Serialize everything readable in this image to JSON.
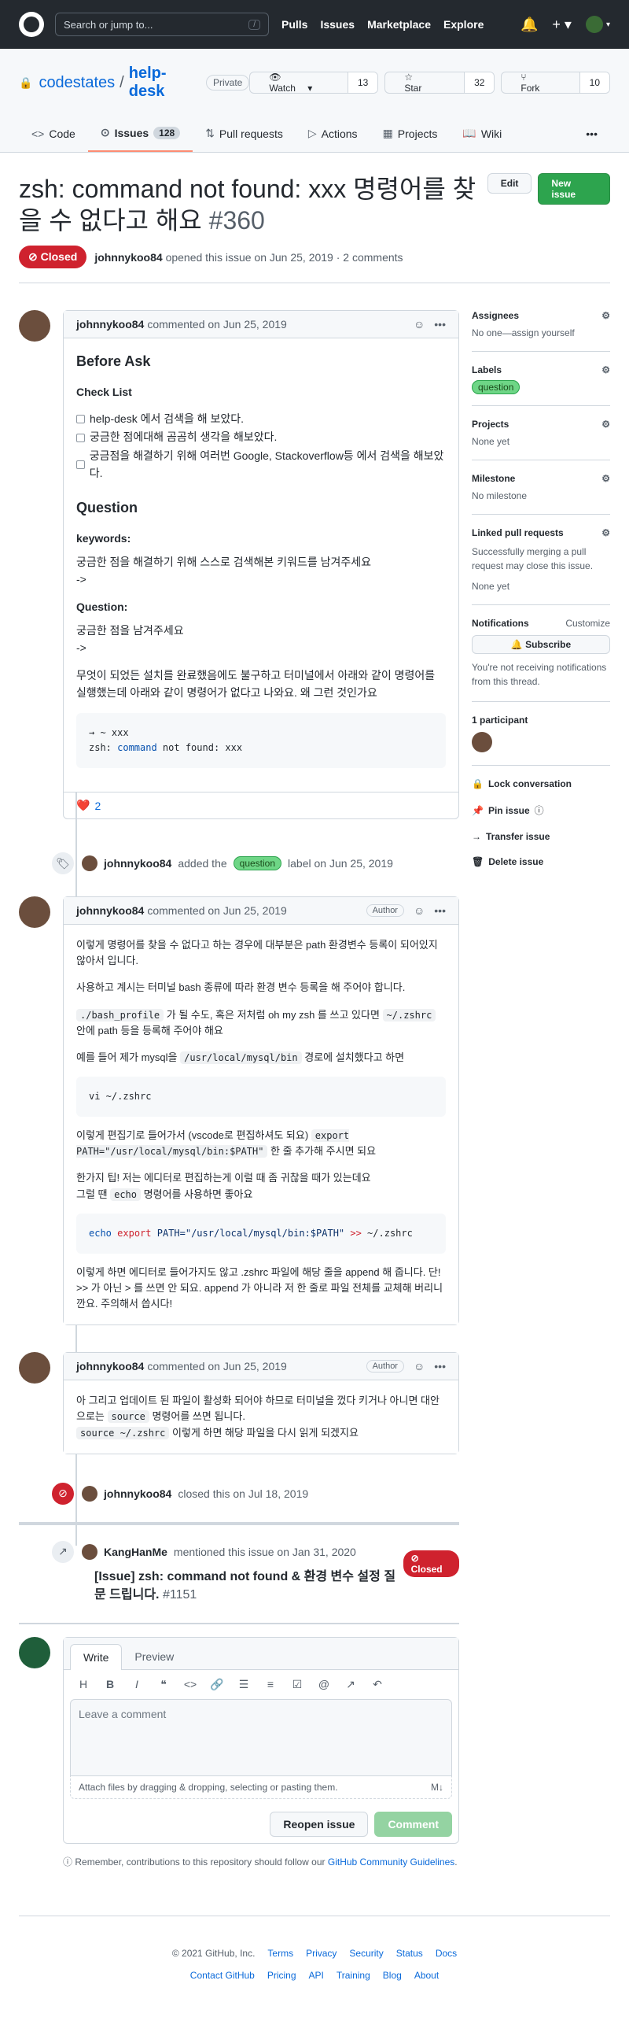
{
  "header": {
    "search_placeholder": "Search or jump to...",
    "search_shortcut": "/",
    "nav": [
      "Pulls",
      "Issues",
      "Marketplace",
      "Explore"
    ]
  },
  "repo": {
    "owner": "codestates",
    "name": "help-desk",
    "visibility": "Private",
    "watch_label": "Watch",
    "watch_count": "13",
    "star_label": "Star",
    "star_count": "32",
    "fork_label": "Fork",
    "fork_count": "10",
    "tabs": [
      {
        "label": "Code"
      },
      {
        "label": "Issues",
        "count": "128"
      },
      {
        "label": "Pull requests"
      },
      {
        "label": "Actions"
      },
      {
        "label": "Projects"
      },
      {
        "label": "Wiki"
      }
    ]
  },
  "issue": {
    "title": "zsh: command not found: xxx 명령어를 찾을 수 없다고 해요",
    "number": "#360",
    "state": "Closed",
    "edit_label": "Edit",
    "new_issue_label": "New issue",
    "author": "johnnykoo84",
    "meta_text": "opened this issue on Jun 25, 2019 · 2 comments"
  },
  "comment1": {
    "author": "johnnykoo84",
    "meta": "commented on Jun 25, 2019",
    "h_before": "Before Ask",
    "h_checklist": "Check List",
    "tasks": [
      "help-desk 에서 검색을 해 보았다.",
      "궁금한 점에대해 곰곰히 생각을 해보았다.",
      "궁금점을 해결하기 위해 여러번 Google, Stackoverflow등 에서 검색을 해보았다."
    ],
    "h_question": "Question",
    "kw_label": "keywords:",
    "kw_text": "궁금한 점을 해결하기 위해 스스로 검색해본 키워드를 남겨주세요",
    "arrow1": "->",
    "q_label": "Question:",
    "q_text": "궁금한 점을 남겨주세요",
    "arrow2": "->",
    "q_body": "무엇이 되었든 설치를 완료했음에도 불구하고 터미널에서 아래와 같이 명령어를 실행했는데 아래와 같이 명령어가 없다고 나와요. 왜 그런 것인가요",
    "code_line1": "→  ~ xxx",
    "code_line2_a": "zsh: ",
    "code_line2_b": "command",
    "code_line2_c": " not found: xxx",
    "reaction_emoji": "❤️",
    "reaction_count": "2"
  },
  "label_event": {
    "author": "johnnykoo84",
    "text1": "added the",
    "label": "question",
    "text2": "label on Jun 25, 2019"
  },
  "comment2": {
    "author": "johnnykoo84",
    "meta": "commented on Jun 25, 2019",
    "badge": "Author",
    "p1": "이렇게 명령어를 찾을 수 없다고 하는 경우에 대부분은 path 환경변수 등록이 되어있지 않아서 입니다.",
    "p2": "사용하고 계시는 터미널 bash 종류에 따라 환경 변수 등록을 해 주어야 합니다.",
    "p3_code1": "./bash_profile",
    "p3_t1": " 가 될 수도, 혹은 저처럼 oh my zsh 를 쓰고 있다면 ",
    "p3_code2": "~/.zshrc",
    "p3_t2": " 안에 path 등을 등록해 주어야 해요",
    "p4_t1": "예를 들어 제가 mysql을 ",
    "p4_code": "/usr/local/mysql/bin",
    "p4_t2": " 경로에 설치했다고 하면",
    "code1": "vi ~/.zshrc",
    "p5_t1": "이렇게 편집기로 들어가서 (vscode로 편집하셔도 되요) ",
    "p5_code": "export PATH=\"/usr/local/mysql/bin:$PATH\"",
    "p5_t2": " 한 줄 추가해 주시면 되요",
    "p6_l1": "한가지 팁! 저는 에디터로 편집하는게 이럴 때 좀 귀찮을 때가 있는데요",
    "p6_t1": "그럴 땐 ",
    "p6_code": "echo",
    "p6_t2": " 명령어를 사용하면 좋아요",
    "code2_a": "echo",
    "code2_b": "export",
    "code2_c": " PATH=\"/usr/local/mysql/bin:$PATH\" ",
    "code2_d": ">>",
    "code2_e": " ~/.zshrc",
    "p7": "이렇게 하면 에디터로 들어가지도 않고 .zshrc 파일에 해당 줄을 append 해 줍니다. 단! >> 가 아닌 > 를 쓰면 안 되요. append 가 아니라 저 한 줄로 파일 전체를 교체해 버리니깐요. 주의해서 씁시다!"
  },
  "comment3": {
    "author": "johnnykoo84",
    "meta": "commented on Jun 25, 2019",
    "badge": "Author",
    "p1": "아 그리고 업데이트 된 파일이 활성화 되어야 하므로 터미널을 껐다 키거나 아니면 대안으로는 ",
    "p1_code": "source",
    "p1_t2": " 명령어를 쓰면 됩니다.",
    "p2_code": "source ~/.zshrc",
    "p2_t": " 이렇게 하면 해당 파일을 다시 읽게 되겠지요"
  },
  "close_event": {
    "author": "johnnykoo84",
    "text": "closed this on Jul 18, 2019"
  },
  "mention_event": {
    "author": "KangHanMe",
    "text": "mentioned this issue on Jan 31, 2020",
    "ref_title": "[Issue] zsh: command not found & 환경 변수 설정 질문 드립니다.",
    "ref_number": "#1151",
    "ref_state": "Closed"
  },
  "new_comment": {
    "tab_write": "Write",
    "tab_preview": "Preview",
    "placeholder": "Leave a comment",
    "attach": "Attach files by dragging & dropping, selecting or pasting them.",
    "reopen_label": "Reopen issue",
    "comment_label": "Comment",
    "remember_t1": "Remember, contributions to this repository should follow our ",
    "remember_link": "GitHub Community Guidelines",
    "remember_t2": "."
  },
  "sidebar": {
    "assignees_title": "Assignees",
    "assignees_value": "No one—assign yourself",
    "labels_title": "Labels",
    "label": "question",
    "projects_title": "Projects",
    "projects_value": "None yet",
    "milestone_title": "Milestone",
    "milestone_value": "No milestone",
    "linked_title": "Linked pull requests",
    "linked_text": "Successfully merging a pull request may close this issue.",
    "linked_value": "None yet",
    "notif_title": "Notifications",
    "notif_customize": "Customize",
    "subscribe": "Subscribe",
    "notif_text": "You're not receiving notifications from this thread.",
    "participants": "1 participant",
    "lock": "Lock conversation",
    "pin": "Pin issue",
    "transfer": "Transfer issue",
    "delete": "Delete issue"
  },
  "footer": {
    "copyright": "© 2021 GitHub, Inc.",
    "row1": [
      "Terms",
      "Privacy",
      "Security",
      "Status",
      "Docs"
    ],
    "row2": [
      "Contact GitHub",
      "Pricing",
      "API",
      "Training",
      "Blog",
      "About"
    ]
  },
  "colors": {
    "accent": "#0969da",
    "closed": "#cf222e",
    "green": "#2da44e"
  }
}
